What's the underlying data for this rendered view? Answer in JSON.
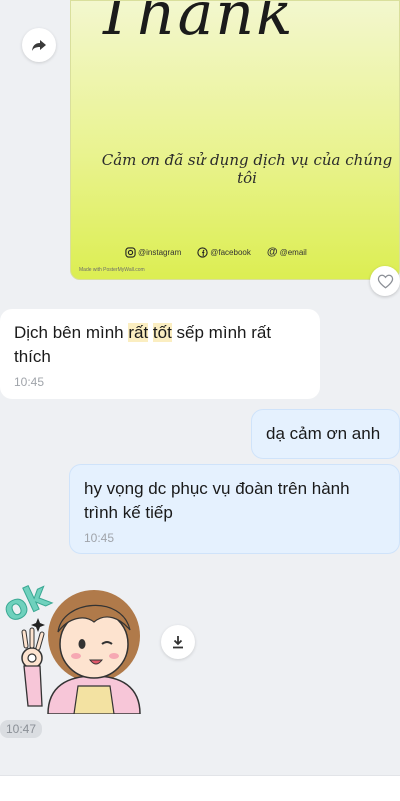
{
  "image_card": {
    "script_title": "Thank",
    "thank_line": "Cảm ơn đã sử dụng dịch vụ của chúng tôi",
    "socials": [
      "@instagram",
      "@facebook",
      "@email"
    ],
    "made_with": "Made with PosterMyWall.com"
  },
  "messages": [
    {
      "type": "incoming",
      "text_parts": [
        "Dịch bên mình ",
        "rất",
        " ",
        "tốt",
        " sếp mình rất thích"
      ],
      "time": "10:45"
    },
    {
      "type": "outgoing",
      "text": "dạ cảm ơn anh"
    },
    {
      "type": "outgoing",
      "text": "hy vọng dc phục vụ đoàn trên hành trình kế tiếp",
      "time": "10:45"
    }
  ],
  "sticker": {
    "text": "ok",
    "time": "10:47"
  },
  "colors": {
    "background": "#eef0f3",
    "incoming_bubble": "#ffffff",
    "outgoing_bubble": "#e5f1fe",
    "highlight": "#fbeec1"
  }
}
